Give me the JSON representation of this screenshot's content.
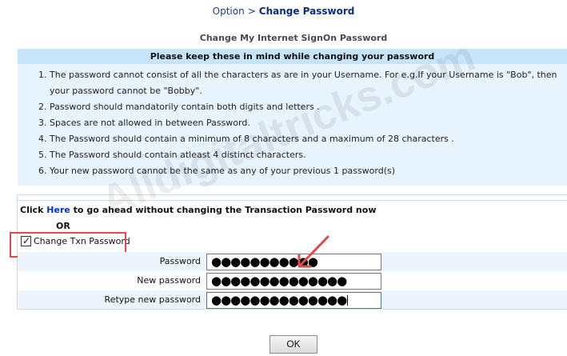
{
  "breadcrumb": {
    "parent": "Option",
    "separator": ">",
    "current": "Change Password"
  },
  "page_title": "Change My Internet SignOn Password",
  "info": {
    "header": "Please keep these in mind while changing your password",
    "rules": [
      {
        "num": "1.",
        "text": "The password cannot consist of all the characters as are in your Username. For e.g.If your Username is \"Bob\", then your password cannot be \"Bobby\"."
      },
      {
        "num": "2.",
        "text": "Password should mandatorily contain both digits and letters ."
      },
      {
        "num": "3.",
        "text": "Spaces are not allowed in between Password."
      },
      {
        "num": "4.",
        "text": "The Password should contain a minimum of 8 characters and a maximum of 28 characters ."
      },
      {
        "num": "5.",
        "text": "The Password should contain atleast 4 distinct characters."
      },
      {
        "num": "6.",
        "text": "Your new password cannot be the same as any of your previous 1 password(s)"
      }
    ]
  },
  "skip": {
    "prefix": "Click ",
    "link": "Here",
    "suffix": " to go ahead without changing the Transaction Password now",
    "or": "OR"
  },
  "txn": {
    "label": "Change Txn Password",
    "checked": true
  },
  "form": {
    "password_label": "Password",
    "password_value": "●●●●●●●●●●●",
    "new_password_label": "New password",
    "new_password_value": "●●●●●●●●●●●●●●",
    "retype_label": "Retype new password",
    "retype_value": "●●●●●●●●●●●●●●"
  },
  "ok_button": "OK",
  "watermark": "Alldigitaltricks.com",
  "colors": {
    "highlight": "#e04a4a",
    "info_bg": "#e7f3fd",
    "info_header_bg": "#c6e5fb",
    "link": "#0033cc"
  }
}
